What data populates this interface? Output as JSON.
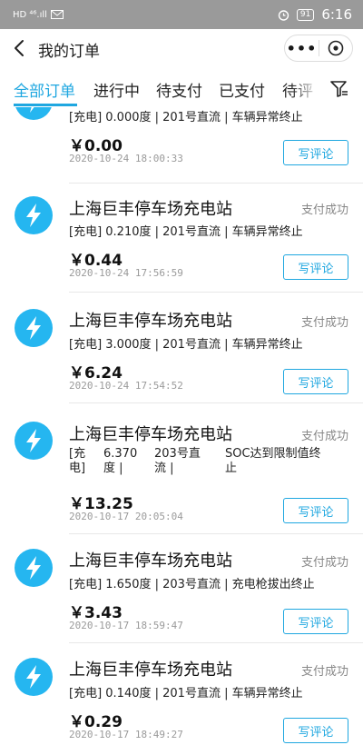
{
  "statusbar": {
    "left_text": "HD ⁴⁶.ıll",
    "battery": "91",
    "time": "6:16"
  },
  "header": {
    "title": "我的订单",
    "more": "•••"
  },
  "tabs": [
    {
      "label": "全部订单"
    },
    {
      "label": "进行中"
    },
    {
      "label": "待支付"
    },
    {
      "label": "已支付"
    },
    {
      "label": "待评"
    }
  ],
  "review_label": "写评论",
  "orders": [
    {
      "station": "",
      "status": "",
      "detail": "[充电] 0.000度 | 201号直流 | 车辆异常终止",
      "amount": "￥0.00",
      "time": "2020-10-24 18:00:33"
    },
    {
      "station": "上海巨丰停车场充电站",
      "status": "支付成功",
      "detail": "[充电] 0.210度 | 201号直流 | 车辆异常终止",
      "amount": "￥0.44",
      "time": "2020-10-24 17:56:59"
    },
    {
      "station": "上海巨丰停车场充电站",
      "status": "支付成功",
      "detail": "[充电] 3.000度 | 201号直流 | 车辆异常终止",
      "amount": "￥6.24",
      "time": "2020-10-24 17:54:52"
    },
    {
      "station": "上海巨丰停车场充电站",
      "status": "支付成功",
      "detail_cols": [
        "[充\n电]",
        "6.370\n度 |",
        "203号直\n流 |",
        "SOC达到限制值终\n止"
      ],
      "amount": "￥13.25",
      "time": "2020-10-17 20:05:04"
    },
    {
      "station": "上海巨丰停车场充电站",
      "status": "支付成功",
      "detail": "[充电] 1.650度 | 203号直流 | 充电枪拔出终止",
      "amount": "￥3.43",
      "time": "2020-10-17 18:59:47"
    },
    {
      "station": "上海巨丰停车场充电站",
      "status": "支付成功",
      "detail": "[充电] 0.140度 | 201号直流 | 车辆异常终止",
      "amount": "￥0.29",
      "time": "2020-10-17 18:49:27"
    }
  ]
}
